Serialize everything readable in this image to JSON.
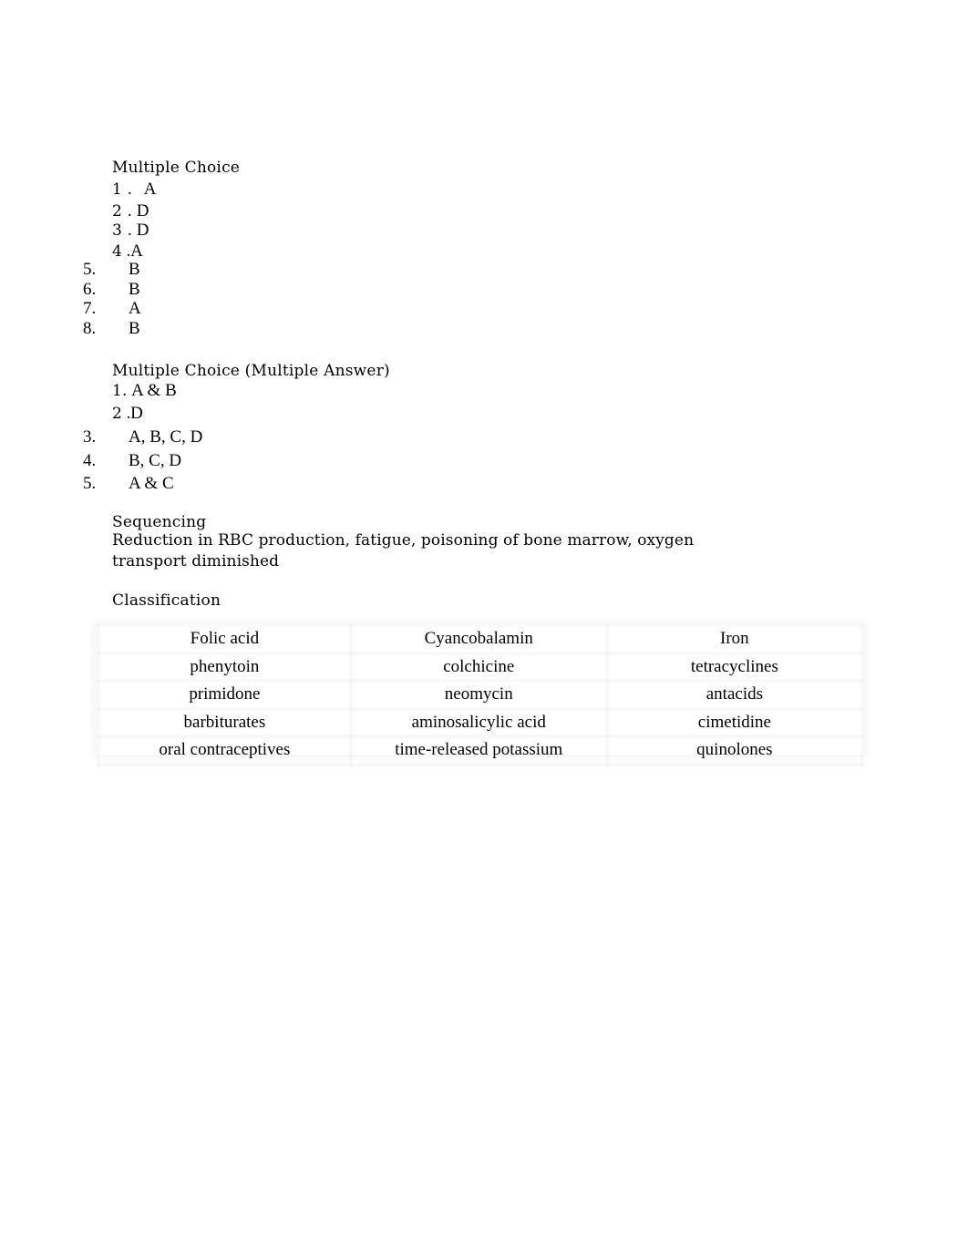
{
  "sections": {
    "multiple_choice": {
      "heading": "Multiple Choice",
      "items_inline": [
        {
          "num": "1 .",
          "answer": "A"
        },
        {
          "num": "2 .",
          "answer": "D"
        },
        {
          "num": "3 .",
          "answer": "D"
        },
        {
          "num": "4 .",
          "answer": "A"
        }
      ],
      "items_list": [
        {
          "num": "5.",
          "answer": "B"
        },
        {
          "num": "6.",
          "answer": "B"
        },
        {
          "num": "7.",
          "answer": "A"
        },
        {
          "num": "8.",
          "answer": "B"
        }
      ]
    },
    "multiple_answer": {
      "heading": "Multiple Choice (Multiple Answer)",
      "items_inline": [
        {
          "num": "1.",
          "answer": "A & B"
        },
        {
          "num": "2 .",
          "answer": "D"
        }
      ],
      "items_list": [
        {
          "num": "3.",
          "answer": "A, B, C, D"
        },
        {
          "num": "4.",
          "answer": "B, C, D"
        },
        {
          "num": "5.",
          "answer": "A & C"
        }
      ]
    },
    "sequencing": {
      "heading": "Sequencing",
      "text": "Reduction in RBC production, fatigue, poisoning of bone marrow, oxygen transport diminished"
    },
    "classification": {
      "heading": "Classification",
      "table": {
        "headers": [
          "Folic acid",
          "Cyancobalamin",
          "Iron"
        ],
        "rows": [
          [
            "phenytoin",
            "colchicine",
            "tetracyclines"
          ],
          [
            "primidone",
            "neomycin",
            "antacids"
          ],
          [
            "barbiturates",
            "aminosalicylic acid",
            "cimetidine"
          ],
          [
            "oral contraceptives",
            "time-released potassium",
            "quinolones"
          ]
        ]
      }
    }
  }
}
